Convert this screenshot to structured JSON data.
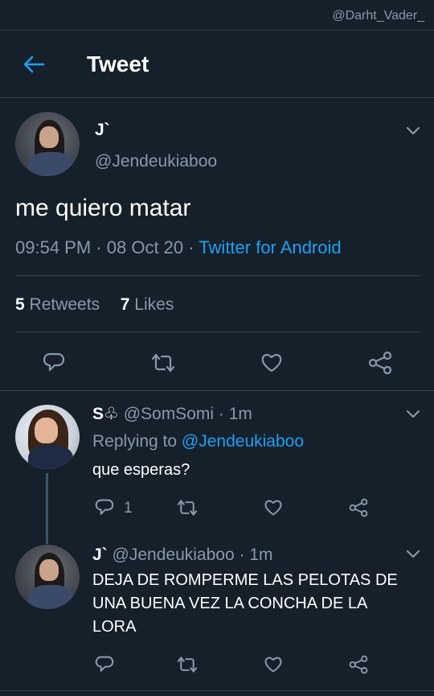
{
  "watermark": "@Darht_Vader_",
  "header": {
    "title": "Tweet"
  },
  "tweet": {
    "name": "J`",
    "handle": "@Jendeukiaboo",
    "text": "me quiero matar",
    "time": "09:54 PM",
    "sep1": "·",
    "date": "08 Oct 20",
    "sep2": "·",
    "source": "Twitter for Android",
    "retweets_count": "5",
    "retweets_label": "Retweets",
    "likes_count": "7",
    "likes_label": "Likes"
  },
  "replies": [
    {
      "name": "S♧",
      "handle": "@SomSomi",
      "sep": "·",
      "time": "1m",
      "replying_prefix": "Replying to",
      "replying_to": "@Jendeukiaboo",
      "text": "que esperas?",
      "reply_count": "1"
    },
    {
      "name": "J`",
      "handle": "@Jendeukiaboo",
      "sep": "·",
      "time": "1m",
      "text_lines": [
        "DEJA DE ROMPERME LAS PELOTAS DE",
        "UNA BUENA VEZ LA CONCHA DE LA",
        "LORA"
      ]
    }
  ],
  "colors": {
    "background": "#15202b",
    "accent": "#1da1f2",
    "muted": "#8899a6",
    "divider": "#38444d"
  },
  "icons": [
    "back-arrow-icon",
    "chevron-down-icon",
    "reply-icon",
    "retweet-icon",
    "like-icon",
    "share-icon"
  ]
}
